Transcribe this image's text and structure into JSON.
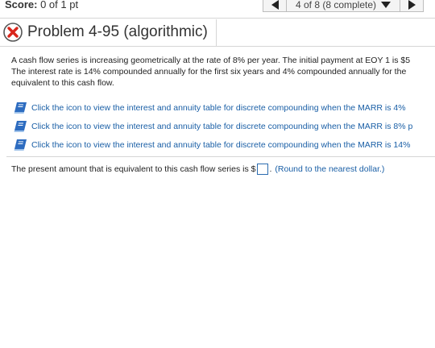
{
  "header": {
    "score_label": "Score:",
    "score_value": "0 of 1 pt",
    "progress": "4 of 8 (8 complete)"
  },
  "problem": {
    "title": "Problem 4-95 (algorithmic)",
    "status": "incorrect"
  },
  "question": {
    "lines": [
      "A cash flow series is increasing geometrically at the rate of 8% per year. The initial payment at EOY 1 is $5",
      "The interest rate is 14% compounded annually for the first six years and 4% compounded annually for the",
      "equivalent to this cash flow."
    ]
  },
  "table_links": [
    {
      "label": "Click the icon to view the interest and annuity table for discrete compounding when the MARR is 4%"
    },
    {
      "label": "Click the icon to view the interest and annuity table for discrete compounding when the MARR is 8% p"
    },
    {
      "label": "Click the icon to view the interest and annuity table for discrete compounding when the MARR is 14%"
    }
  ],
  "answer": {
    "prompt": "The present amount that is equivalent to this cash flow series is $",
    "value": "",
    "period": ".",
    "hint": "(Round to the nearest dollar.)"
  },
  "colors": {
    "link": "#1a5fa6",
    "incorrect": "#d9261c",
    "book": "#2d6cc0"
  },
  "icons": [
    "incorrect-x-icon",
    "prev-arrow-icon",
    "dropdown-arrow-icon",
    "next-arrow-icon",
    "book-icon"
  ]
}
